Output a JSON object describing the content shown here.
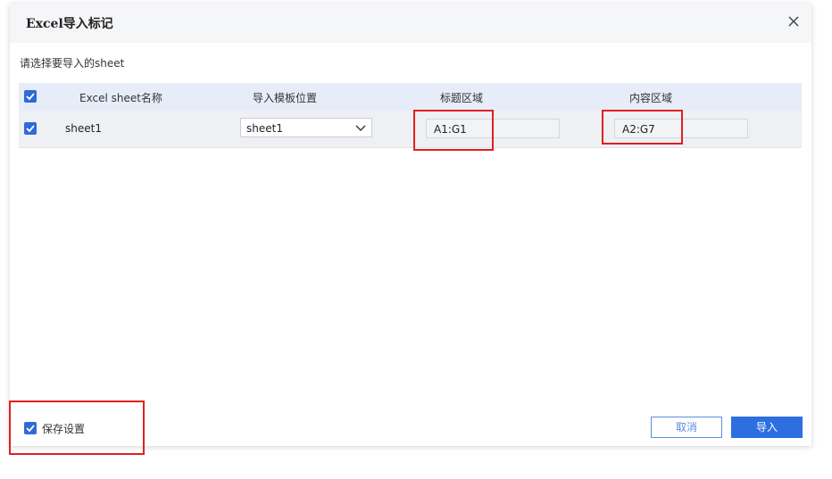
{
  "dialog": {
    "title": "Excel导入标记",
    "close_icon": "close-icon"
  },
  "subtitle": "请选择要导入的sheet",
  "table": {
    "headers": {
      "sheet_name": "Excel sheet名称",
      "template_position": "导入模板位置",
      "title_area": "标题区域",
      "content_area": "内容区域"
    },
    "header_checkbox_checked": true,
    "rows": [
      {
        "checked": true,
        "sheet_name": "sheet1",
        "template_position": "sheet1",
        "title_area": "A1:G1",
        "content_area": "A2:G7"
      }
    ]
  },
  "footer": {
    "save_settings_label": "保存设置",
    "save_settings_checked": true,
    "cancel_label": "取消",
    "import_label": "导入"
  },
  "colors": {
    "accent": "#2d6ee0",
    "highlight": "#e02020"
  }
}
